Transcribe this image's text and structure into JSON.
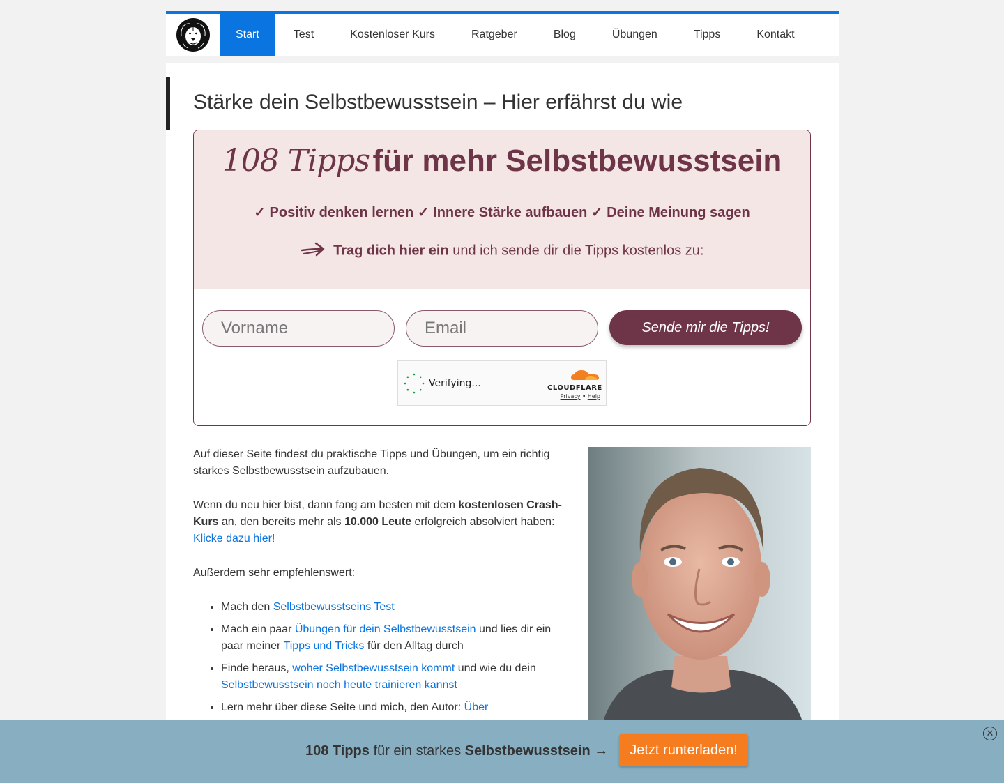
{
  "nav": {
    "items": [
      "Start",
      "Test",
      "Kostenloser Kurs",
      "Ratgeber",
      "Blog",
      "Übungen",
      "Tipps",
      "Kontakt"
    ],
    "active_index": 0
  },
  "page": {
    "title": "Stärke dein Selbstbewusstsein – Hier erfährst du wie"
  },
  "optin": {
    "headline_script": "108 Tipps",
    "headline_bold": "für mehr Selbstbewusstsein",
    "benefits": "✓ Positiv denken lernen ✓ Innere Stärke aufbauen ✓ Deine Meinung sagen",
    "cta_bold": "Trag dich hier ein",
    "cta_rest": "und ich sende dir die Tipps kostenlos zu:",
    "firstname_placeholder": "Vorname",
    "email_placeholder": "Email",
    "submit_label": "Sende mir die Tipps!",
    "captcha": {
      "status": "Verifying...",
      "brand": "CLOUDFLARE",
      "privacy": "Privacy",
      "separator": "•",
      "help": "Help"
    }
  },
  "article": {
    "p1": "Auf dieser Seite findest du praktische Tipps und Übungen, um ein richtig starkes Selbstbewusstsein aufzubauen.",
    "p2_a": "Wenn du neu hier bist, dann fang am besten mit dem ",
    "p2_bold1": "kostenlosen Crash-Kurs",
    "p2_b": " an, den bereits mehr als ",
    "p2_bold2": "10.000 Leute",
    "p2_c": " erfolgreich absolviert haben: ",
    "p2_link": "Klicke dazu hier!",
    "p3": "Außerdem sehr empfehlenswert:",
    "list": [
      {
        "pre": "Mach den ",
        "link1": "Selbstbewusstseins Test",
        "mid": "",
        "link2": "",
        "post": ""
      },
      {
        "pre": "Mach ein paar ",
        "link1": "Übungen für dein Selbstbewusstsein",
        "mid": " und lies dir ein paar meiner ",
        "link2": "Tipps und Tricks",
        "post": " für den Alltag durch"
      },
      {
        "pre": "Finde heraus, ",
        "link1": "woher Selbstbewusstsein kommt",
        "mid": " und wie du dein ",
        "link2": "Selbstbewusstsein noch heute trainieren kannst",
        "post": ""
      },
      {
        "pre": "Lern mehr über diese Seite und mich, den Autor: ",
        "link1": "Über",
        "mid": "",
        "link2": "",
        "post": ""
      }
    ]
  },
  "bottombar": {
    "bold1": "108 Tipps",
    "text": " für ein starkes ",
    "bold2": "Selbstbewusstsein",
    "arrow": " →",
    "button": "Jetzt runterladen!",
    "close": "✕"
  },
  "colors": {
    "accent": "#0a74e0",
    "brand": "#6e3548",
    "optin_bg": "#f5e6e6",
    "bar_bg": "#87aec1",
    "bar_button": "#f57c1f"
  }
}
